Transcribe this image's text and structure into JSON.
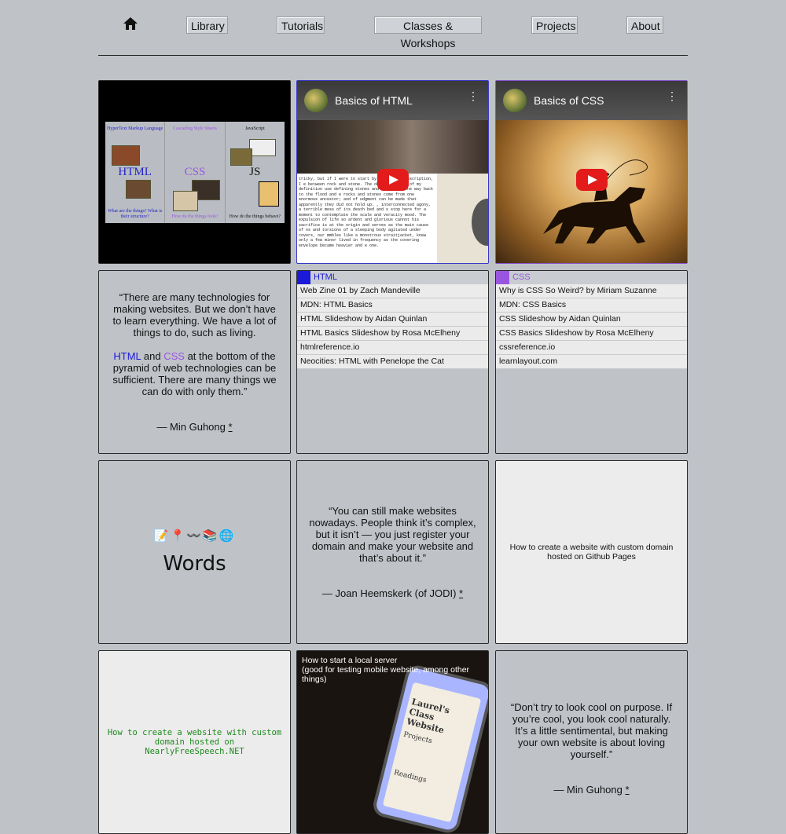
{
  "nav": {
    "home_icon": "home-icon",
    "items": [
      "Library",
      "Tutorials",
      "Classes & Workshops",
      "Projects",
      "About"
    ]
  },
  "diagram": {
    "col1_top": "HyperText Markup Language",
    "col1_big": "HTML",
    "col1_foot": "What are the things? What is their structure?",
    "col2_top": "Cascading Style Sheets",
    "col2_big": "CSS",
    "col2_foot": "How do the things look?",
    "col3_top": "JavaScript",
    "col3_big": "JS",
    "col3_foot": "How do the things behave?"
  },
  "videos": {
    "html_title": "Basics of HTML",
    "css_title": "Basics of CSS",
    "html_page_text": "tricky, but if I were to start by the way of description, I e between rock and stone. The obvious defect of my definition use defining stones and rocks all the way back to the flood and e rocks and stones come from one enormous ancestor; and of udgment can be made that apparently they did not hold up. , interconnected agony, a terrible mess of its death bed and s stop here for a moment to contemplate the scale and veracity mood. The expulsion of life so ardent and glorious cannot his sacrifice is at the origin and serves as the main cause of ns and torsions of a sleeping body agitated under covers, our mmbles like a monstrous straitjacket, knew only a few minor lived in frequency as the covering envelope became heavier and e one."
  },
  "quote1": {
    "line1": "“There are many technologies for making websites. But we don’t have to learn everything. We have a lot of things to do, such as living.",
    "html": "HTML",
    "and": " and ",
    "css": "CSS",
    "line2": " at the bottom of the pyramid of web technologies can be sufficient. There are many things we can do with only them.”",
    "attribution": "— Min Guhong ",
    "asterisk": "*"
  },
  "html_list": {
    "heading": "HTML",
    "accent": "#1a1ad8",
    "items": [
      "Web Zine 01 by Zach Mandeville",
      "MDN: HTML Basics",
      "HTML Slideshow by Aidan Quinlan",
      "HTML Basics Slideshow by Rosa McElheny",
      "htmlreference.io",
      "Neocities: HTML with Penelope the Cat"
    ]
  },
  "css_list": {
    "heading": "CSS",
    "accent": "#9a55e0",
    "items": [
      "Why is CSS So Weird? by Miriam Suzanne",
      "MDN: CSS Basics",
      "CSS Slideshow by Aidan Quinlan",
      "CSS Basics Slideshow by Rosa McElheny",
      "cssreference.io",
      "learnlayout.com"
    ]
  },
  "words": {
    "emojis": "📝📍〰️📚🌐",
    "title": "Words"
  },
  "quote2": {
    "text": "“You can still make websites nowadays. People think it’s complex, but it isn’t — you just register your domain and make your website and that’s about it.”",
    "attribution": "— Joan Heemskerk (of JODI) ",
    "asterisk": "*"
  },
  "github_card": {
    "text": "How to create a website with custom domain hosted on Github Pages"
  },
  "nfs_card": {
    "text": "How to create a website with custom domain hosted on NearlyFreeSpeech.NET"
  },
  "server_card": {
    "line1": "How to start a local server",
    "line2": "(good for testing mobile website, among other things)",
    "phone_title": "Laurel's Class Website",
    "phone_sub1": "Projects",
    "phone_sub2": "Readings"
  },
  "quote3": {
    "text": "“Don’t try to look cool on purpose. If you’re cool, you look cool naturally. It’s a little sentimental, but making your own website is about loving yourself.”",
    "attribution": "— Min Guhong ",
    "asterisk": "*"
  }
}
